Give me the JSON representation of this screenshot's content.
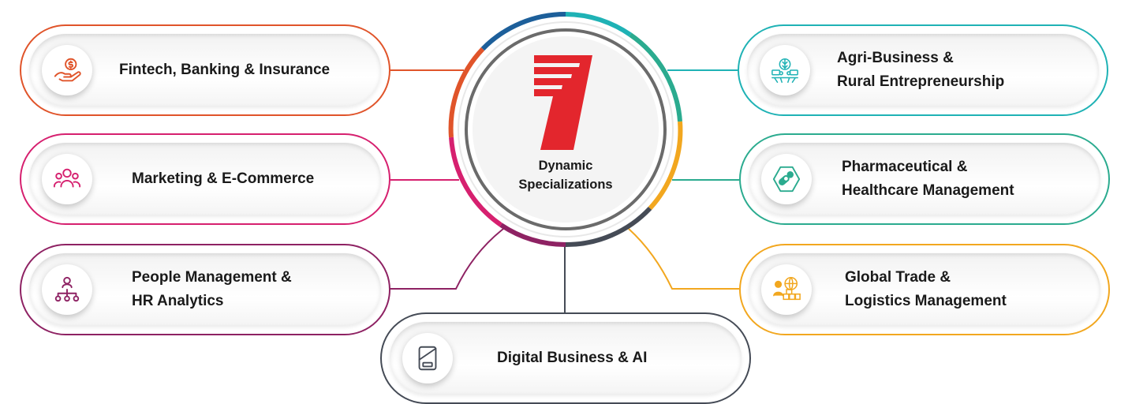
{
  "hub": {
    "logo_text": "7",
    "title_line1": "Dynamic",
    "title_line2": "Specializations",
    "logo_color": "#e3262d"
  },
  "specializations": [
    {
      "lines": [
        "Fintech, Banking & Insurance"
      ],
      "color": "#e0542a",
      "icon": "money-hand-icon"
    },
    {
      "lines": [
        "Marketing & E-Commerce"
      ],
      "color": "#d6206f",
      "icon": "people-group-icon"
    },
    {
      "lines": [
        "People Management &",
        "HR Analytics"
      ],
      "color": "#8e2263",
      "icon": "org-chart-icon"
    },
    {
      "lines": [
        "Digital Business & AI"
      ],
      "color": "#454b56",
      "icon": "tablet-icon"
    },
    {
      "lines": [
        "Agri-Business &",
        "Rural Entrepreneurship"
      ],
      "color": "#1fb2b5",
      "icon": "agriculture-icon"
    },
    {
      "lines": [
        "Pharmaceutical &",
        "Healthcare Management"
      ],
      "color": "#2bab8f",
      "icon": "pills-icon"
    },
    {
      "lines": [
        "Global Trade &",
        "Logistics Management"
      ],
      "color": "#f2a71f",
      "icon": "global-trade-icon"
    }
  ]
}
